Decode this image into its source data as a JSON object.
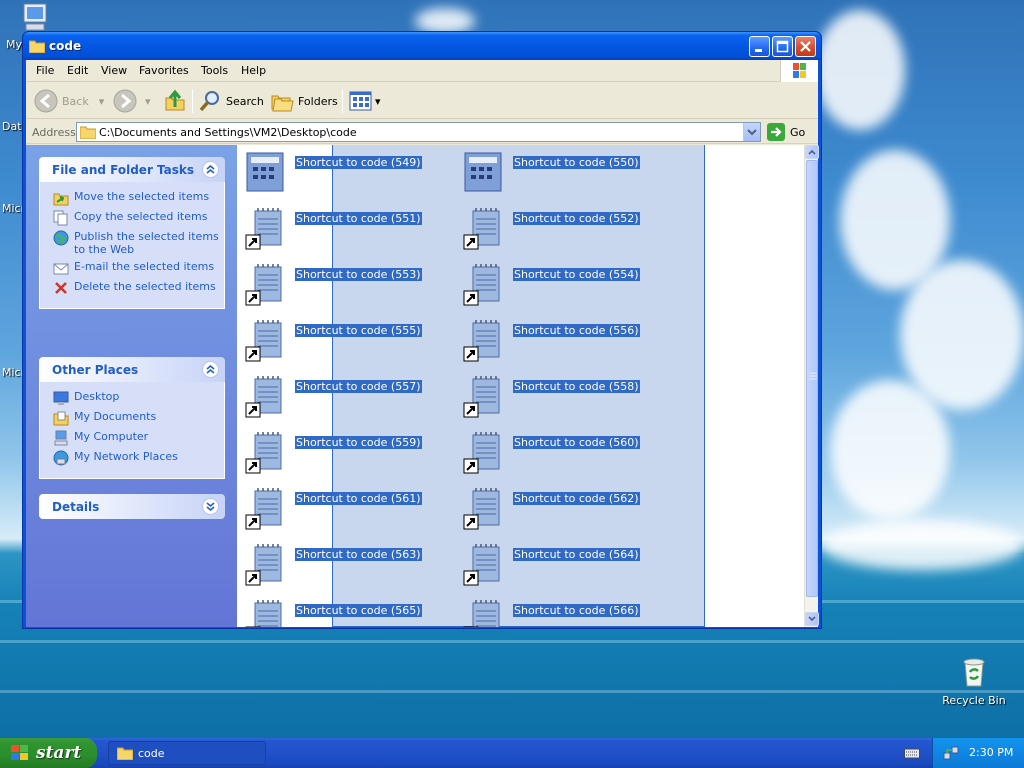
{
  "desktop": {
    "icons": [
      {
        "label": "My"
      },
      {
        "label": "Dat"
      },
      {
        "label": "Micro"
      },
      {
        "label": "Micro"
      },
      {
        "label": "Recycle Bin"
      }
    ]
  },
  "window": {
    "title": "code",
    "menu": [
      "File",
      "Edit",
      "View",
      "Favorites",
      "Tools",
      "Help"
    ],
    "toolbar": {
      "back_label": "Back",
      "search_label": "Search",
      "folders_label": "Folders"
    },
    "address": {
      "label": "Address",
      "value": "C:\\Documents and Settings\\VM2\\Desktop\\code",
      "go_label": "Go"
    },
    "taskpane": {
      "file_tasks": {
        "title": "File and Folder Tasks",
        "items": [
          "Move the selected items",
          "Copy the selected items",
          "Publish the selected items to the Web",
          "E-mail the selected items",
          "Delete the selected items"
        ]
      },
      "other_places": {
        "title": "Other Places",
        "items": [
          "Desktop",
          "My Documents",
          "My Computer",
          "My Network Places"
        ]
      },
      "details": {
        "title": "Details"
      }
    },
    "files": [
      "Shortcut to code (549)",
      "Shortcut to code (550)",
      "Shortcut to code (551)",
      "Shortcut to code (552)",
      "Shortcut to code (553)",
      "Shortcut to code (554)",
      "Shortcut to code (555)",
      "Shortcut to code (556)",
      "Shortcut to code (557)",
      "Shortcut to code (558)",
      "Shortcut to code (559)",
      "Shortcut to code (560)",
      "Shortcut to code (561)",
      "Shortcut to code (562)",
      "Shortcut to code (563)",
      "Shortcut to code (564)",
      "Shortcut to code (565)",
      "Shortcut to code (566)"
    ]
  },
  "taskbar": {
    "start_label": "start",
    "task_button": "code",
    "clock": "2:30 PM"
  },
  "colors": {
    "title_blue": "#0a5ae6",
    "selection": "#316ac5",
    "link_blue": "#215dc6",
    "start_green": "#2f9430"
  }
}
